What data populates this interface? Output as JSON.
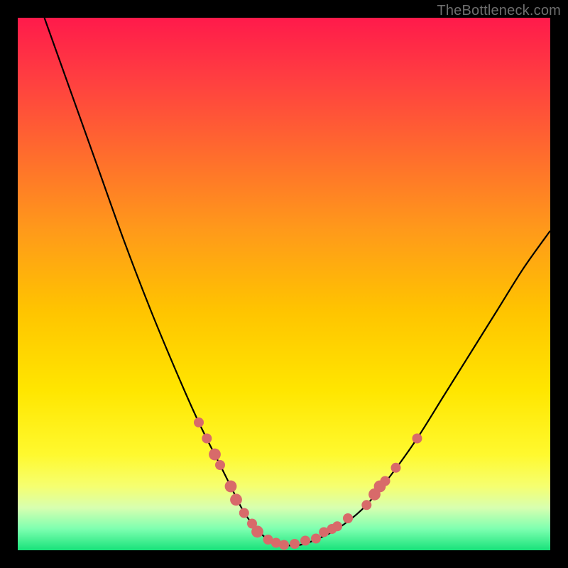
{
  "watermark": "TheBottleneck.com",
  "colors": {
    "frame_bg_top": "#ff1a4b",
    "frame_bg_bottom": "#18e27a",
    "curve": "#000000",
    "marker": "#d86a6a",
    "page_bg": "#000000",
    "watermark_text": "#6e6e6e"
  },
  "chart_data": {
    "type": "line",
    "title": "",
    "xlabel": "",
    "ylabel": "",
    "xlim": [
      0,
      100
    ],
    "ylim": [
      0,
      100
    ],
    "grid": false,
    "legend": false,
    "series": [
      {
        "name": "bottleneck-curve",
        "x": [
          5,
          10,
          15,
          20,
          25,
          30,
          34,
          38,
          40,
          42,
          44,
          47,
          50,
          53,
          56,
          60,
          65,
          70,
          75,
          80,
          85,
          90,
          95,
          100
        ],
        "y": [
          100,
          86,
          72,
          58,
          45,
          33,
          24,
          16,
          12,
          8,
          5,
          2,
          1,
          1,
          2,
          4,
          8,
          14,
          21,
          29,
          37,
          45,
          53,
          60
        ]
      }
    ],
    "markers": [
      {
        "x": 34.0,
        "y": 24.0,
        "r": 1.0
      },
      {
        "x": 35.5,
        "y": 21.0,
        "r": 1.0
      },
      {
        "x": 37.0,
        "y": 18.0,
        "r": 1.2
      },
      {
        "x": 38.0,
        "y": 16.0,
        "r": 1.0
      },
      {
        "x": 40.0,
        "y": 12.0,
        "r": 1.2
      },
      {
        "x": 41.0,
        "y": 9.5,
        "r": 1.2
      },
      {
        "x": 42.5,
        "y": 7.0,
        "r": 1.0
      },
      {
        "x": 44.0,
        "y": 5.0,
        "r": 1.0
      },
      {
        "x": 45.0,
        "y": 3.5,
        "r": 1.2
      },
      {
        "x": 47.0,
        "y": 2.0,
        "r": 1.0
      },
      {
        "x": 48.5,
        "y": 1.4,
        "r": 1.0
      },
      {
        "x": 50.0,
        "y": 1.0,
        "r": 1.0
      },
      {
        "x": 52.0,
        "y": 1.2,
        "r": 1.0
      },
      {
        "x": 54.0,
        "y": 1.8,
        "r": 1.0
      },
      {
        "x": 56.0,
        "y": 2.2,
        "r": 1.0
      },
      {
        "x": 57.5,
        "y": 3.4,
        "r": 1.0
      },
      {
        "x": 59.0,
        "y": 4.0,
        "r": 1.0
      },
      {
        "x": 60.0,
        "y": 4.5,
        "r": 1.0
      },
      {
        "x": 62.0,
        "y": 6.0,
        "r": 1.0
      },
      {
        "x": 65.5,
        "y": 8.5,
        "r": 1.0
      },
      {
        "x": 67.0,
        "y": 10.5,
        "r": 1.2
      },
      {
        "x": 68.0,
        "y": 12.0,
        "r": 1.2
      },
      {
        "x": 69.0,
        "y": 13.0,
        "r": 1.0
      },
      {
        "x": 71.0,
        "y": 15.5,
        "r": 1.0
      },
      {
        "x": 75.0,
        "y": 21.0,
        "r": 1.0
      }
    ]
  }
}
